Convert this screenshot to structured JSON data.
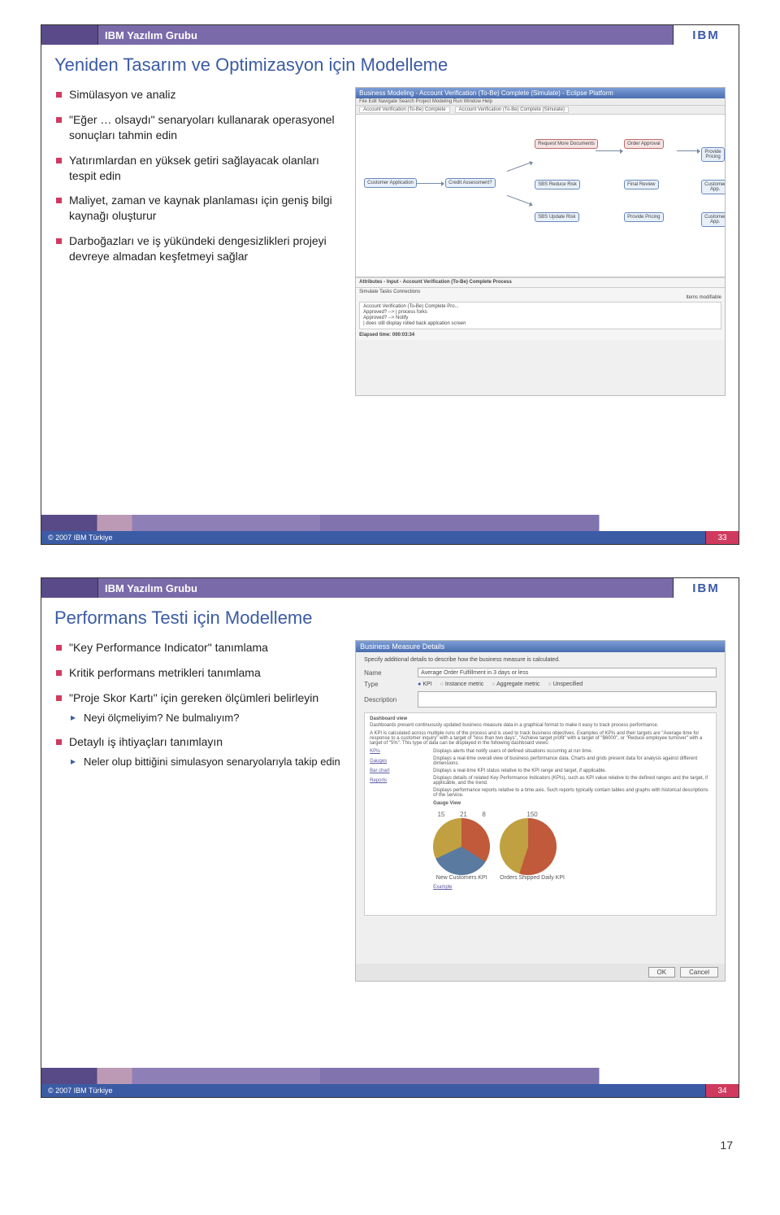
{
  "page_number": "17",
  "slides": [
    {
      "group": "IBM Yazılım Grubu",
      "logo": "IBM",
      "title": "Yeniden Tasarım ve Optimizasyon için Modelleme",
      "bullets": [
        {
          "text": "Simülasyon ve analiz"
        },
        {
          "text": "\"Eğer … olsaydı\" senaryoları kullanarak operasyonel sonuçları tahmin edin"
        },
        {
          "text": "Yatırımlardan en yüksek getiri sağlayacak olanları tespit edin"
        },
        {
          "text": "Maliyet, zaman ve kaynak planlaması için geniş bilgi kaynağı oluşturur"
        },
        {
          "text": "Darboğazları ve iş yükündeki dengesizlikleri projeyi devreye almadan keşfetmeyi sağlar"
        }
      ],
      "screenshot": {
        "window_title": "Business Modeling - Account Verification (To-Be) Complete (Simulate) - Eclipse Platform",
        "menu": "File  Edit  Navigate  Search  Project  Modeling  Run  Window  Help",
        "tab1": "Account Verification (To-Be) Complete",
        "tab2": "Account Verification (To-Be) Complete (Simulate)",
        "nodes": {
          "start": "Customer Application",
          "credit": "Credit Assessment?",
          "request": "Request More Documents",
          "approval": "Order Approval",
          "review": "Final Review",
          "provide": "Provide Pricing",
          "reduce": "SBS Reduce Risk",
          "update": "SBS Update Risk",
          "end": "Customer App."
        },
        "bottom_panel_title": "Attributes - Input - Account Verification (To-Be) Complete Process",
        "tabs_row": "Simulate   Tasks   Connections",
        "setting_label": "Items modifiable",
        "settings": [
          "Account Verification (To-Be) Complete Pro...",
          "Approved? --> | process forks",
          "Approved? --> Notify",
          "| does still display rolled back applcation screen"
        ],
        "elapsed": "Elapsed time: 000:03:34"
      },
      "copyright": "© 2007 IBM Türkiye",
      "number": "33"
    },
    {
      "group": "IBM Yazılım Grubu",
      "logo": "IBM",
      "title": "Performans Testi için Modelleme",
      "bullets": [
        {
          "text": "\"Key Performance Indicator\" tanımlama"
        },
        {
          "text": "Kritik performans metrikleri tanımlama"
        },
        {
          "text": "\"Proje Skor Kartı\" için gereken ölçümleri belirleyin",
          "sub": [
            "Neyi ölçmeliyim? Ne bulmalıyım?"
          ]
        },
        {
          "text": "Detaylı iş ihtiyaçları tanımlayın",
          "sub": [
            "Neler olup bittiğini simulasyon senaryolarıyla takip edin"
          ]
        }
      ],
      "dialog": {
        "title": "Business Measure Details",
        "subtitle": "Specify additional details to describe how the business measure is calculated.",
        "name_label": "Name",
        "name_value": "Average Order Fulfillment in 3 days or less",
        "type_label": "Type",
        "type_options": [
          "KPI",
          "Instance metric",
          "Aggregate metric",
          "Unspecified"
        ],
        "type_selected": "KPI",
        "desc_label": "Description",
        "dashboard_header": "Dashboard view",
        "dashboard_intro": "Dashboards present continuously updated business measure data in a graphical format to make it easy to track process performance.",
        "kpi_note": "A KPI is calculated across multiple runs of the process and is used to track business objectives. Examples of KPIs and their targets are \"Average time for response to a customer inquiry\" with a target of \"less than two days\", \"Achieve target profit\" with a target of \"$6000\", or \"Reduce employee turnover\" with a target of \"5%\". This type of data can be displayed in the following dashboard views:",
        "side_links": [
          "KPIs",
          "Gauges",
          "Bar chart",
          "Reports"
        ],
        "side_texts": [
          "Displays alerts that notify users of defined situations occurring at run time.",
          "Displays a real-time overall view of business performance data. Charts and grids present data for analysis against different dimensions.",
          "Displays a real-time KPI status relative to the KPI range and target, if applicable.",
          "Displays details of related Key Performance Indicators (KPIs), such as KPI value relative to the defined ranges and the target, if applicable, and the trend.",
          "Displays performance reports relative to a time axis. Such reports typically contain tables and graphs with historical descriptions of the service."
        ],
        "gauge_title": "Gauge View",
        "chart1_title": "New Customers KPI",
        "chart2_title": "Orders Shipped Daily KPI",
        "example": "Example",
        "ok": "OK",
        "cancel": "Cancel"
      },
      "chart_data": [
        {
          "type": "pie",
          "title": "New Customers KPI",
          "labels": [
            "15",
            "21",
            "8"
          ],
          "series": [
            {
              "name": "segments",
              "values": [
                34,
                34,
                32
              ]
            }
          ]
        },
        {
          "type": "pie",
          "title": "Orders Shipped Daily KPI",
          "labels": [
            "150"
          ],
          "series": [
            {
              "name": "segments",
              "values": [
                55,
                45
              ]
            }
          ]
        }
      ],
      "copyright": "© 2007 IBM Türkiye",
      "number": "34"
    }
  ]
}
